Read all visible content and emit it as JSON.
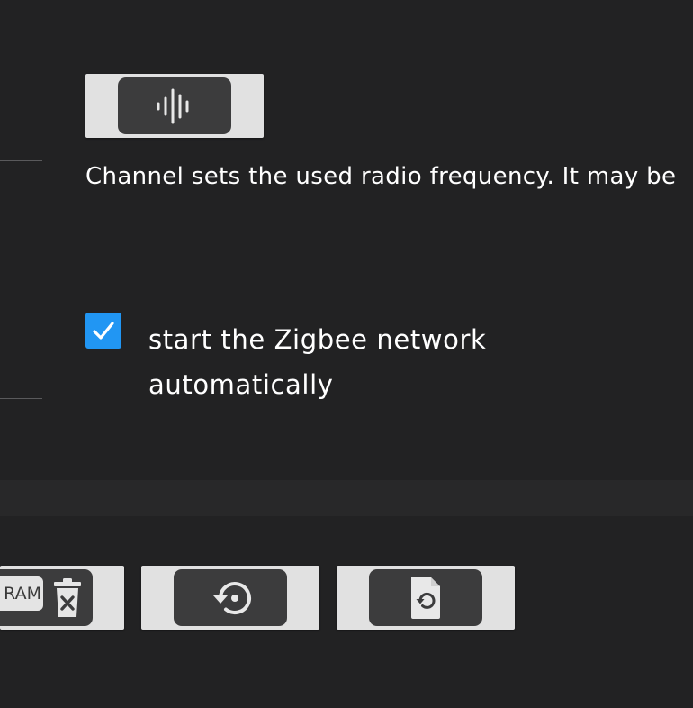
{
  "channel": {
    "scan_button_icon": "sound-wave-icon",
    "description": "Channel sets the used radio frequency. It may be"
  },
  "autostart": {
    "checked": true,
    "label": "start the Zigbee network automatically"
  },
  "toolbar": {
    "clear_nvram": {
      "text": "RAM",
      "icon": "trash-x-icon"
    },
    "restore_button_icon": "restore-icon",
    "restore_file_button_icon": "file-restore-icon"
  },
  "colors": {
    "background": "#222223",
    "card": "#e1e1e1",
    "button_inner": "#3c3c3d",
    "checkbox": "#2196f3"
  }
}
